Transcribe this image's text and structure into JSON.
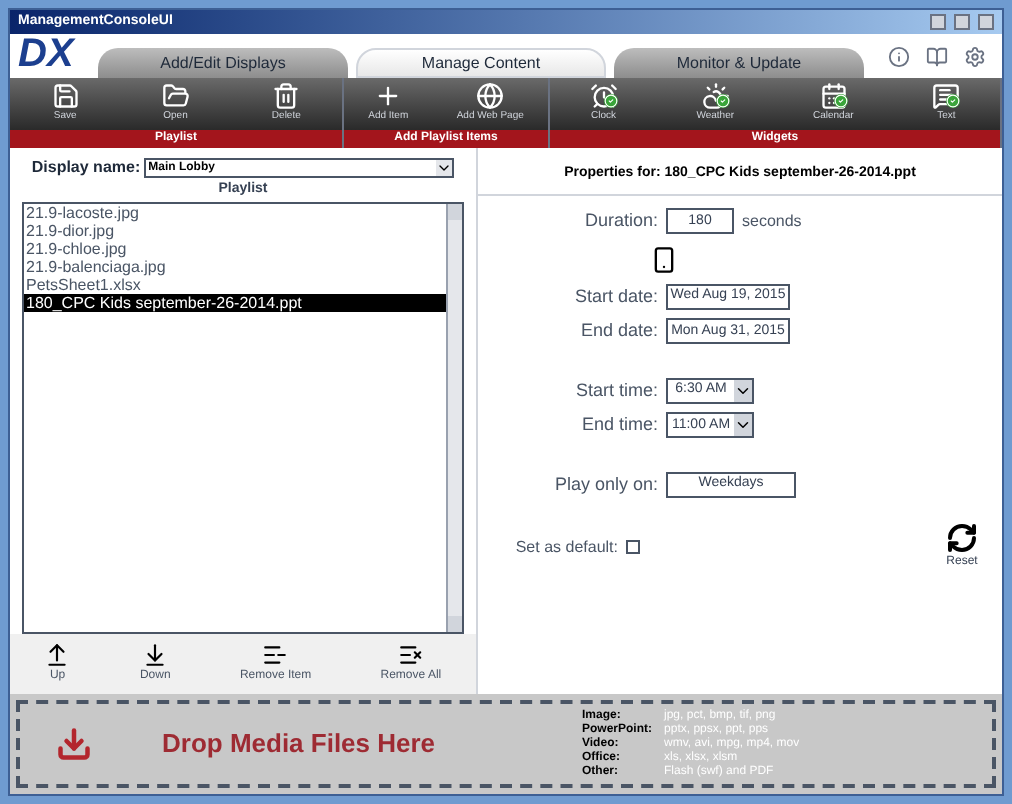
{
  "window": {
    "title": "ManagementConsoleUI"
  },
  "logo": {
    "text": "DX"
  },
  "tabs": [
    {
      "label": "Add/Edit Displays",
      "selected": false
    },
    {
      "label": "Manage Content",
      "selected": true
    },
    {
      "label": "Monitor & Update",
      "selected": false
    }
  ],
  "header_icons": [
    {
      "kind": "info"
    },
    {
      "kind": "book"
    },
    {
      "kind": "settings"
    }
  ],
  "toolbar_groups": [
    {
      "label": "Playlist",
      "tools": [
        {
          "kind": "save",
          "label": "Save",
          "enabled": false
        },
        {
          "kind": "open",
          "label": "Open",
          "enabled": false
        },
        {
          "kind": "delete",
          "label": "Delete",
          "enabled": false
        }
      ]
    },
    {
      "label": "Add Playlist Items",
      "tools": [
        {
          "kind": "add",
          "label": "Add Item",
          "enabled": false
        },
        {
          "kind": "web",
          "label": "Add Web Page",
          "enabled": false
        }
      ]
    },
    {
      "label": "Widgets",
      "tools": [
        {
          "kind": "clock",
          "label": "Clock",
          "enabled": true
        },
        {
          "kind": "weather",
          "label": "Weather",
          "enabled": true
        },
        {
          "kind": "calendar",
          "label": "Calendar",
          "enabled": true
        },
        {
          "kind": "text",
          "label": "Text",
          "enabled": true
        }
      ]
    }
  ],
  "display_name": {
    "label": "Display name:",
    "value": "Main Lobby"
  },
  "playlist": {
    "title": "Playlist",
    "items": [
      {
        "name": "21.9-lacoste.jpg",
        "selected": false
      },
      {
        "name": "21.9-dior.jpg",
        "selected": false
      },
      {
        "name": "21.9-chloe.jpg",
        "selected": false
      },
      {
        "name": "21.9-balenciaga.jpg",
        "selected": false
      },
      {
        "name": "PetsSheet1.xlsx",
        "selected": false
      },
      {
        "name": "180_CPC Kids september-26-2014.ppt",
        "selected": true
      }
    ]
  },
  "list_buttons": [
    {
      "kind": "up",
      "label": "Up"
    },
    {
      "kind": "down",
      "label": "Down"
    },
    {
      "kind": "remove",
      "label": "Remove Item"
    },
    {
      "kind": "remove_all",
      "label": "Remove All"
    }
  ],
  "properties": {
    "title": "Properties for: 180_CPC Kids september-26-2014.ppt",
    "duration": {
      "label": "Duration:",
      "value": "180",
      "unit": "seconds"
    },
    "start_date": {
      "label": "Start date:",
      "value": "Wed Aug 19, 2015"
    },
    "end_date": {
      "label": "End date:",
      "value": "Mon Aug 31, 2015"
    },
    "start_time": {
      "label": "Start time:",
      "value": "6:30 AM"
    },
    "end_time": {
      "label": "End time:",
      "value": "11:00 AM"
    },
    "play_only_on": {
      "label": "Play only on:",
      "value": "Weekdays"
    },
    "set_as_default": {
      "label": "Set as default:",
      "checked": false
    },
    "reset": {
      "label": "Reset"
    }
  },
  "drop_zone": {
    "label": "Drop Media Files Here",
    "formats": [
      {
        "type": "Image:",
        "extensions": "jpg, pct, bmp, tif, png"
      },
      {
        "type": "PowerPoint:",
        "extensions": "pptx, ppsx, ppt, pps"
      },
      {
        "type": "Video:",
        "extensions": "wmv, avi, mpg, mp4, mov"
      },
      {
        "type": "Office:",
        "extensions": "xls, xlsx, xlsm"
      },
      {
        "type": "Other:",
        "extensions": "Flash (swf) and PDF"
      }
    ]
  }
}
